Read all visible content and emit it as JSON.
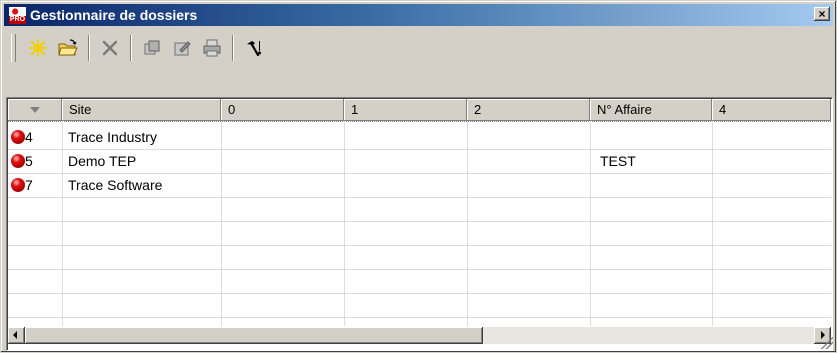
{
  "window": {
    "title": "Gestionnaire de dossiers",
    "icon_text": "PRO",
    "close_label": "×"
  },
  "toolbar": {
    "buttons": [
      {
        "name": "new",
        "icon": "asterisk-icon",
        "color": "#f0d000"
      },
      {
        "name": "open",
        "icon": "open-folder-icon",
        "color": "#c8a000"
      },
      {
        "name": "delete",
        "icon": "delete-x-icon",
        "color": "#808080"
      },
      {
        "name": "copy",
        "icon": "copy-icon",
        "color": "#808080"
      },
      {
        "name": "properties",
        "icon": "properties-icon",
        "color": "#808080"
      },
      {
        "name": "print",
        "icon": "print-icon",
        "color": "#808080"
      },
      {
        "name": "tools",
        "icon": "hammer-icon",
        "color": "#000000"
      }
    ]
  },
  "grid": {
    "columns": [
      "",
      "Site",
      "0",
      "1",
      "2",
      "N° Affaire",
      "4"
    ],
    "rows": [
      {
        "id": "4",
        "site": "Trace Industry",
        "c0": "",
        "c1": "",
        "c2": "",
        "affaire": "",
        "c4": ""
      },
      {
        "id": "5",
        "site": "Demo TEP",
        "c0": "",
        "c1": "",
        "c2": "",
        "affaire": "TEST",
        "c4": ""
      },
      {
        "id": "7",
        "site": "Trace Software",
        "c0": "",
        "c1": "",
        "c2": "",
        "affaire": "",
        "c4": ""
      }
    ],
    "status_color": "#e01010"
  }
}
